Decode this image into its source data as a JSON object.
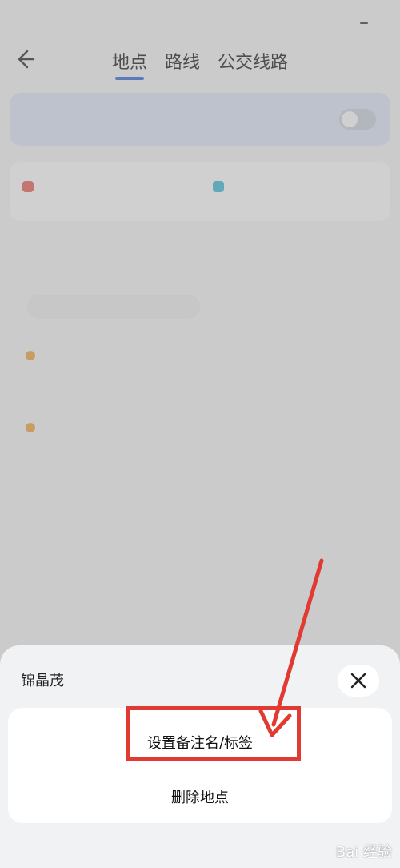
{
  "status_bar": {
    "time": "",
    "net": "",
    "battery": ""
  },
  "nav": {
    "tabs": [
      {
        "label": "地点",
        "active": true
      },
      {
        "label": "路线",
        "active": false
      },
      {
        "label": "公交线路",
        "active": false
      }
    ]
  },
  "sheet": {
    "title": "锦晶茂",
    "actions": [
      {
        "label": "设置备注名/标签"
      },
      {
        "label": "删除地点"
      }
    ]
  },
  "watermark": {
    "text": "Bai 经验"
  },
  "colors": {
    "accent": "#2a63d6",
    "annotation_red": "#e03a32",
    "place_dot": "#f0a23a"
  },
  "icons": {
    "back": "back-arrow-icon",
    "close": "close-icon"
  }
}
